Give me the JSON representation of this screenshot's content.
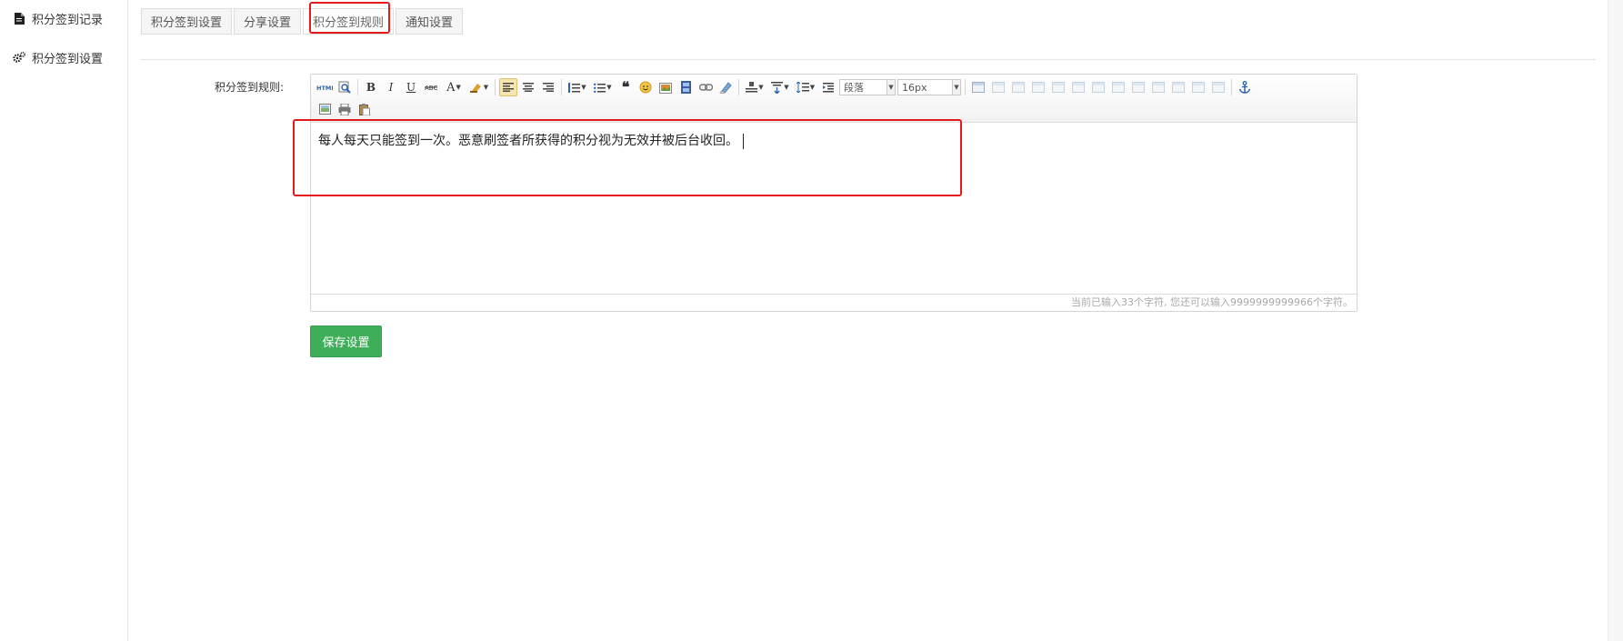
{
  "sidebar": {
    "items": [
      {
        "label": "积分签到记录",
        "icon": "document-icon"
      },
      {
        "label": "积分签到设置",
        "icon": "gears-icon"
      }
    ]
  },
  "tabs": [
    {
      "label": "积分签到设置"
    },
    {
      "label": "分享设置"
    },
    {
      "label": "积分签到规则"
    },
    {
      "label": "通知设置"
    }
  ],
  "form": {
    "label": "积分签到规则:",
    "editor": {
      "paragraph_select": "段落",
      "fontsize_select": "16px",
      "content": "每人每天只能签到一次。恶意刷签者所获得的积分视为无效并被后台收回。",
      "status": "当前已输入33个字符, 您还可以输入9999999999966个字符。"
    },
    "save_label": "保存设置"
  },
  "colors": {
    "highlight": "#e3191b",
    "save_button": "#3fae59"
  }
}
